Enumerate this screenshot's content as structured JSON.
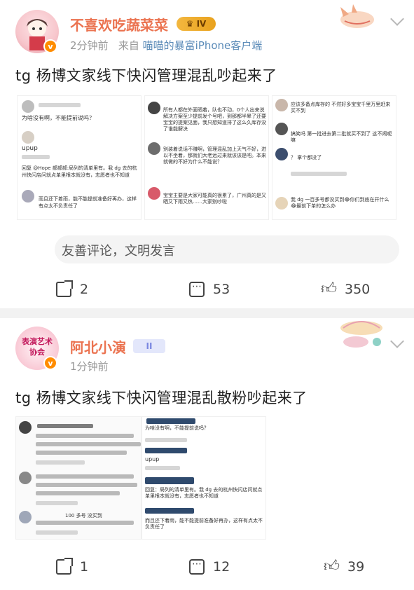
{
  "posts": [
    {
      "username": "不喜欢吃蔬菜菜",
      "time": "2分钟前",
      "source_prefix": "来自",
      "source": "喵喵的暴富iPhone客户端",
      "level_badge": "IV",
      "content": "tg 杨博文家线下快闪管理混乱吵起来了",
      "comment_placeholder": "友善评论，文明发言",
      "reposts": "2",
      "comments": "53",
      "likes": "350"
    },
    {
      "username": "阿北小演",
      "time": "1分钟前",
      "level_badge": "II",
      "avatar_text": "表演艺术协会",
      "content": "tg 杨博文家线下快闪管理混乱散粉吵起来了",
      "reposts": "1",
      "comments": "12",
      "likes": "39"
    }
  ],
  "screenshot_text": {
    "a1": "为啥没有啊，不能提前说吗？",
    "a2": "upup",
    "a3": "回复 @Hope 郝郝郝:局列的清单里有。我 dg 去的杭州快闪店问就点单里根本就没有，志愿者也不知道",
    "a4": "而且还下着雨，能不能提前准备好再办，这样有点太不负责任了",
    "b1": "所有人都在外面晒着，队也不动，0个人出来说解决方案至少提前发个号吧，到那都半晕了还要宝宝的提案见面，我只想知道排了这么久库存没了谁能解决",
    "b2": "别装着说话不赚啊，管理混乱加上天气不好，进以不坐着，那就们大老远过来就该该是吧。本来就做的不好为什么不能说？",
    "b3": "宝宝主要是大家可能真的很累了，广州真的是又晒又下雨又热……大家别吵啦",
    "c1": "应该多备点库存的 不然好多宝宝千里万里赶来买不到",
    "c2": "搞笑吗 第一批进去第二批就买不到了 这不闹呢嘛",
    "c3": "？ 拿个都没了",
    "c4": "我 dg 一百多号都没买到😂你们到底在开什么😂最前下单的怎么办",
    "d1": "为啥没有啊，不能提前说吗？",
    "d2": "upup",
    "d3": "回复：局列的清单里有。我 dg 去的杭州快闪店问就点单里根本就没有，志愿者也不知道",
    "d4": "而且还下着雨，能不能提前准备好再办，这样有点太不负责任了",
    "e1": "100 多号 没买到"
  },
  "colors": {
    "username": "#eb7350",
    "accent_badge": "#f3b73f",
    "source_link": "#5b8bb8"
  },
  "icons": [
    "forward-icon",
    "comment-icon",
    "like-icon",
    "chevron-down-icon",
    "verified-icon"
  ]
}
